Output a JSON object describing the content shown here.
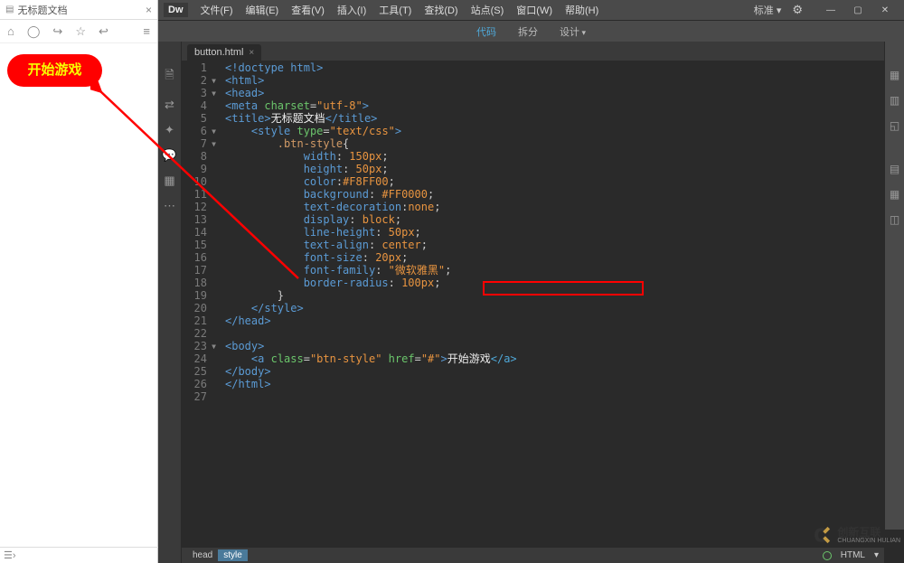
{
  "preview": {
    "tab_title": "无标题文档",
    "button_label": "开始游戏"
  },
  "dw": {
    "logo": "Dw",
    "menu": [
      "文件(F)",
      "编辑(E)",
      "查看(V)",
      "插入(I)",
      "工具(T)",
      "查找(D)",
      "站点(S)",
      "窗口(W)",
      "帮助(H)"
    ],
    "layout_label": "标准 ▾",
    "view_tabs": {
      "code": "代码",
      "split": "拆分",
      "design": "设计"
    },
    "file_tab": "button.html",
    "breadcrumbs": [
      "head",
      "style"
    ],
    "status_lang": "HTML"
  },
  "code": {
    "lines": [
      {
        "n": 1,
        "fold": "",
        "html": "<span class='c-tag'>&lt;!doctype html&gt;</span>"
      },
      {
        "n": 2,
        "fold": "▼",
        "html": "<span class='c-tag'>&lt;html&gt;</span>"
      },
      {
        "n": 3,
        "fold": "▼",
        "html": "<span class='c-tag'>&lt;head&gt;</span>"
      },
      {
        "n": 4,
        "fold": "",
        "html": "<span class='c-tag'>&lt;meta</span> <span class='c-attr'>charset</span>=<span class='c-str'>\"utf-8\"</span><span class='c-tag'>&gt;</span>"
      },
      {
        "n": 5,
        "fold": "",
        "html": "<span class='c-tag'>&lt;title&gt;</span><span class='c-white'>无标题文档</span><span class='c-tag'>&lt;/title&gt;</span>"
      },
      {
        "n": 6,
        "fold": "▼",
        "html": "    <span class='c-tag'>&lt;style</span> <span class='c-attr'>type</span>=<span class='c-str'>\"text/css\"</span><span class='c-tag'>&gt;</span>"
      },
      {
        "n": 7,
        "fold": "▼",
        "html": "        <span class='c-sel'>.btn-style</span>{"
      },
      {
        "n": 8,
        "fold": "",
        "html": "            <span class='c-prop'>width</span>: <span class='c-val'>150px</span>;"
      },
      {
        "n": 9,
        "fold": "",
        "html": "            <span class='c-prop'>height</span>: <span class='c-val'>50px</span>;"
      },
      {
        "n": 10,
        "fold": "",
        "html": "            <span class='c-prop'>color</span>:<span class='c-val'>#F8FF00</span>;"
      },
      {
        "n": 11,
        "fold": "",
        "html": "            <span class='c-prop'>background</span>: <span class='c-val'>#FF0000</span>;"
      },
      {
        "n": 12,
        "fold": "",
        "html": "            <span class='c-prop'>text-decoration</span>:<span class='c-val'>none</span>;"
      },
      {
        "n": 13,
        "fold": "",
        "html": "            <span class='c-prop'>display</span>: <span class='c-val'>block</span>;"
      },
      {
        "n": 14,
        "fold": "",
        "html": "            <span class='c-prop'>line-height</span>: <span class='c-val'>50px</span>;"
      },
      {
        "n": 15,
        "fold": "",
        "html": "            <span class='c-prop'>text-align</span>: <span class='c-val'>center</span>;"
      },
      {
        "n": 16,
        "fold": "",
        "html": "            <span class='c-prop'>font-size</span>: <span class='c-val'>20px</span>;"
      },
      {
        "n": 17,
        "fold": "",
        "html": "            <span class='c-prop'>font-family</span>: <span class='c-val'>\"微软雅黑\"</span>;"
      },
      {
        "n": 18,
        "fold": "",
        "html": "            <span class='c-prop'>border-radius</span>: <span class='c-val'>100px</span>;"
      },
      {
        "n": 19,
        "fold": "",
        "html": "        }"
      },
      {
        "n": 20,
        "fold": "",
        "html": "    <span class='c-tag'>&lt;/style&gt;</span>"
      },
      {
        "n": 21,
        "fold": "",
        "html": "<span class='c-tag'>&lt;/head&gt;</span>"
      },
      {
        "n": 22,
        "fold": "",
        "html": ""
      },
      {
        "n": 23,
        "fold": "▼",
        "html": "<span class='c-tag'>&lt;body&gt;</span>"
      },
      {
        "n": 24,
        "fold": "",
        "html": "    <span class='c-tag'>&lt;a</span> <span class='c-attr'>class</span>=<span class='c-str'>\"btn-style\"</span> <span class='c-attr'>href</span>=<span class='c-str'>\"#\"</span><span class='c-tag'>&gt;</span><span class='c-white'>开始游戏</span><span class='c-link'>&lt;/a&gt;</span>"
      },
      {
        "n": 25,
        "fold": "",
        "html": "<span class='c-tag'>&lt;/body&gt;</span>"
      },
      {
        "n": 26,
        "fold": "",
        "html": "<span class='c-tag'>&lt;/html&gt;</span>"
      },
      {
        "n": 27,
        "fold": "",
        "html": ""
      }
    ]
  },
  "watermark": {
    "brand": "创新互联",
    "sub": "CHUANGXIN HULIAN"
  }
}
